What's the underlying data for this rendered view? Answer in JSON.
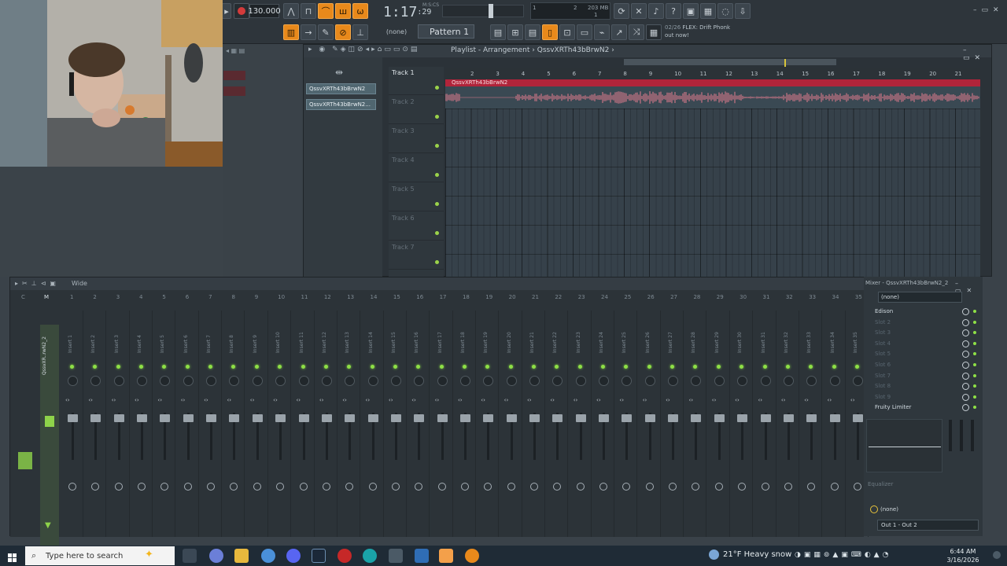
{
  "toolbar": {
    "tempo": "130.000",
    "time_main": "1:17",
    "time_sub": ":29",
    "time_units": "M:S:CS",
    "cpu_bar": "1",
    "cpu_num": "2",
    "memory": "203 MB",
    "voices": "1",
    "pattern_none": "(none)",
    "pattern": "Pattern 1",
    "news_counter": "02/26",
    "news_text": "FLEX: Drift Phonk",
    "news_sub": "out now!",
    "icons": [
      "undo-icon",
      "record-icon",
      "metronome-icon",
      "wait-icon",
      "countdown-icon",
      "loop-icon",
      "snap-icon",
      "cpu-meter-icon",
      "mixer-icon",
      "help-icon",
      "save-icon",
      "plugin-icon",
      "chat-icon",
      "download-icon"
    ]
  },
  "playlist": {
    "title": "Playlist - Arrangement",
    "separator": "›",
    "project": "QssvXRTh43bBrwN2",
    "patterns": [
      "QssvXRTh43bBrwN2",
      "QssvXRTh43bBrwN2..."
    ],
    "tracks": [
      "Track 1",
      "Track 2",
      "Track 3",
      "Track 4",
      "Track 5",
      "Track 6",
      "Track 7"
    ],
    "ruler": [
      "2",
      "3",
      "4",
      "5",
      "6",
      "7",
      "8",
      "9",
      "10",
      "11",
      "12",
      "13",
      "14",
      "15",
      "16",
      "17",
      "18",
      "19",
      "20",
      "21"
    ],
    "clip_name": "QssvXRTh43bBrwN2"
  },
  "mixer": {
    "mode": "Wide",
    "master_label": "M",
    "master_name": "QssvXR..rwN2_2",
    "strips": [
      "1",
      "2",
      "3",
      "4",
      "5",
      "6",
      "7",
      "8",
      "9",
      "10",
      "11",
      "12",
      "13",
      "14",
      "15",
      "16",
      "17",
      "18",
      "19",
      "20",
      "21",
      "22",
      "23",
      "24",
      "25",
      "26",
      "27",
      "28",
      "29",
      "30",
      "31",
      "32",
      "33",
      "34",
      "35"
    ],
    "insert_prefix": "Insert",
    "right_title": "Mixer - QssvXRTh43bBrwN2_2",
    "preset": "(none)",
    "slots": [
      "Edison",
      "Slot 2",
      "Slot 3",
      "Slot 4",
      "Slot 5",
      "Slot 6",
      "Slot 7",
      "Slot 8",
      "Slot 9",
      "Fruity Limiter"
    ],
    "equalizer": "Equalizer",
    "out_none": "(none)",
    "output": "Out 1 - Out 2"
  },
  "taskbar": {
    "search_placeholder": "Type here to search",
    "weather": "21°F  Heavy snow",
    "time": "6:44 AM",
    "date": "3/16/2026"
  },
  "colors": {
    "accent_orange": "#e8891b",
    "clip_red": "#b1243a",
    "waveform_pink": "#e67d8f",
    "led_green": "#8ee046"
  }
}
